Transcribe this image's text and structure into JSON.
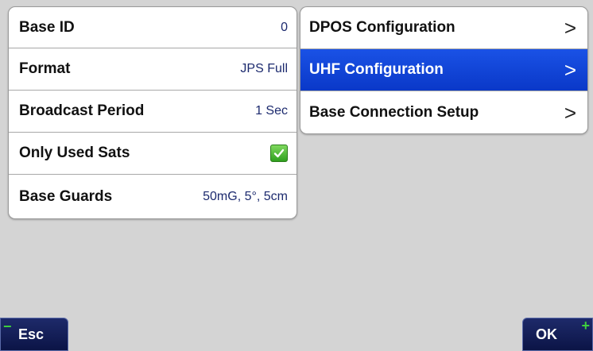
{
  "left_panel": {
    "rows": [
      {
        "label": "Base ID",
        "value": "0"
      },
      {
        "label": "Format",
        "value": "JPS Full"
      },
      {
        "label": "Broadcast Period",
        "value": "1 Sec"
      },
      {
        "label": "Only Used Sats",
        "checked": true
      },
      {
        "label": "Base Guards",
        "value": "50mG, 5°, 5cm"
      }
    ]
  },
  "right_panel": {
    "items": [
      {
        "label": "DPOS Configuration",
        "selected": false
      },
      {
        "label": "UHF Configuration",
        "selected": true
      },
      {
        "label": "Base Connection Setup",
        "selected": false
      }
    ],
    "chevron": ">"
  },
  "softkeys": {
    "esc": {
      "label": "Esc",
      "sign": "−"
    },
    "ok": {
      "label": "OK",
      "sign": "+"
    }
  },
  "colors": {
    "selected": "#0a38c8",
    "value_text": "#1c2a6e",
    "softkey_bg": "#0b1446",
    "minus_sign": "#3ecf3e",
    "plus_sign": "#3ecf3e"
  }
}
